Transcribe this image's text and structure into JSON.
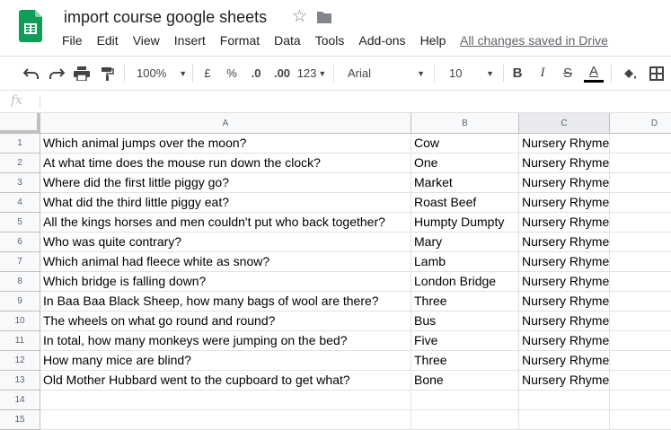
{
  "header": {
    "title": "import course google sheets",
    "save_status": "All changes saved in Drive",
    "menu": [
      "File",
      "Edit",
      "View",
      "Insert",
      "Format",
      "Data",
      "Tools",
      "Add-ons",
      "Help"
    ]
  },
  "toolbar": {
    "zoom": "100%",
    "currency": "£",
    "percent": "%",
    "decimal_decrease": ".0",
    "decimal_increase": ".00",
    "more_formats": "123",
    "font": "Arial",
    "font_size": "10",
    "bold": "B",
    "italic": "I",
    "strikethrough": "S",
    "text_color_glyph": "A",
    "text_color": "#000000"
  },
  "formula_bar": {
    "fx": "fx",
    "value": ""
  },
  "columns": [
    "A",
    "B",
    "C",
    "D"
  ],
  "selected_column": "C",
  "rows": [
    {
      "n": "1",
      "a": "Which animal jumps over the moon?",
      "b": "Cow",
      "c": "Nursery Rhymes"
    },
    {
      "n": "2",
      "a": "At what time does the mouse run down the clock?",
      "b": "One",
      "c": "Nursery Rhymes"
    },
    {
      "n": "3",
      "a": "Where did the first little piggy go?",
      "b": "Market",
      "c": "Nursery Rhymes"
    },
    {
      "n": "4",
      "a": "What did the third little piggy eat?",
      "b": "Roast Beef",
      "c": "Nursery Rhymes"
    },
    {
      "n": "5",
      "a": "All the kings horses and men couldn't put who back together?",
      "b": "Humpty Dumpty",
      "c": "Nursery Rhymes"
    },
    {
      "n": "6",
      "a": "Who was quite contrary?",
      "b": "Mary",
      "c": "Nursery Rhymes"
    },
    {
      "n": "7",
      "a": "Which animal had fleece white as snow?",
      "b": "Lamb",
      "c": "Nursery Rhymes"
    },
    {
      "n": "8",
      "a": "Which bridge is falling down?",
      "b": "London Bridge",
      "c": "Nursery Rhymes"
    },
    {
      "n": "9",
      "a": "In Baa Baa Black Sheep, how many bags of wool are there?",
      "b": "Three",
      "c": "Nursery Rhymes"
    },
    {
      "n": "10",
      "a": "The wheels on what go round and round?",
      "b": "Bus",
      "c": "Nursery Rhymes"
    },
    {
      "n": "11",
      "a": "In total, how many monkeys were jumping on the bed?",
      "b": "Five",
      "c": "Nursery Rhymes"
    },
    {
      "n": "12",
      "a": "How many mice are blind?",
      "b": "Three",
      "c": "Nursery Rhymes"
    },
    {
      "n": "13",
      "a": "Old Mother Hubbard went to the cupboard to get what?",
      "b": "Bone",
      "c": "Nursery Rhymes"
    },
    {
      "n": "14",
      "a": "",
      "b": "",
      "c": ""
    },
    {
      "n": "15",
      "a": "",
      "b": "",
      "c": ""
    }
  ],
  "colors": {
    "brand_green": "#0f9d58",
    "header_bg": "#f8f9fa",
    "selected_header_bg": "#e8eaed",
    "grid_line": "#e2e2e2"
  }
}
